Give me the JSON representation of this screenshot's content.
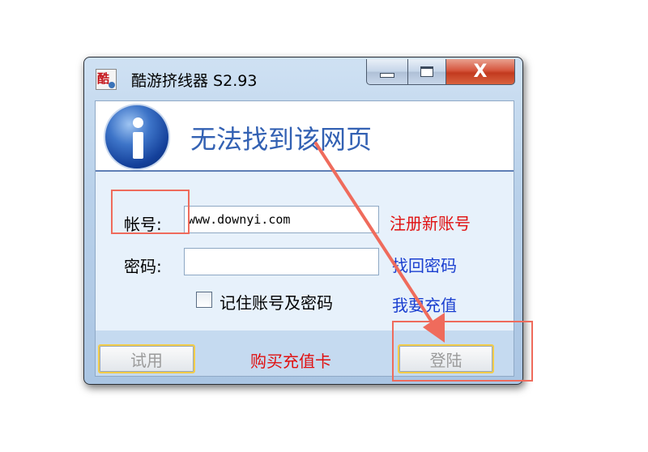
{
  "window": {
    "title": "酷游挤线器 S2.93",
    "close_glyph": "X"
  },
  "banner": {
    "message": "无法找到该网页"
  },
  "form": {
    "account_label": "帐号:",
    "account_value": "www.downyi.com",
    "password_label": "密码:",
    "password_value": "",
    "remember_label": "记住账号及密码",
    "remember_checked": false
  },
  "links": {
    "register": "注册新账号",
    "recover": "找回密码",
    "recharge": "我要充值",
    "buy_card": "购买充值卡"
  },
  "buttons": {
    "trial": "试用",
    "login": "登陆"
  },
  "colors": {
    "link_red": "#e01010",
    "link_blue": "#1a3fd0",
    "banner_text": "#3361b3",
    "annotation": "#ef6b5c"
  }
}
